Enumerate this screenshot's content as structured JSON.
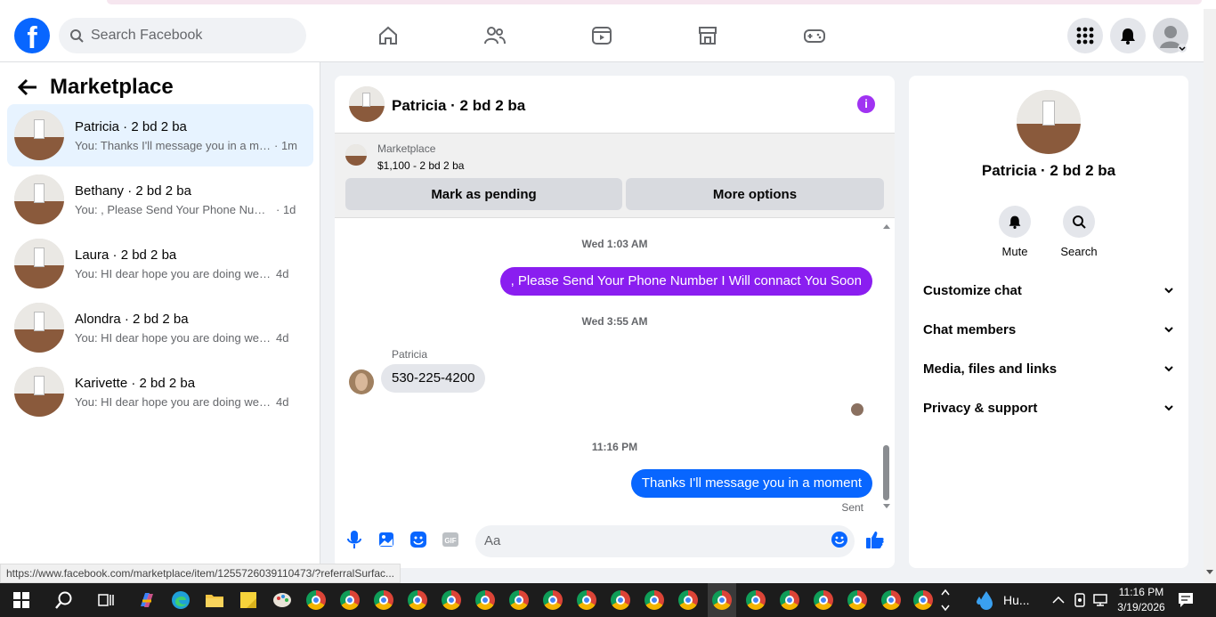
{
  "header": {
    "logo": "f",
    "search_placeholder": "Search Facebook",
    "nav_icons": [
      "home-icon",
      "friends-icon",
      "video-icon",
      "marketplace-icon",
      "gaming-icon"
    ],
    "right_icons": [
      "menu-grid-icon",
      "bell-icon",
      "account-avatar"
    ]
  },
  "sidebar": {
    "title": "Marketplace",
    "conversations": [
      {
        "name": "Patricia · 2 bd 2 ba",
        "preview": "You: Thanks I'll message you in a mo...",
        "time": "· 1m",
        "active": true
      },
      {
        "name": "Bethany · 2 bd 2 ba",
        "preview": "You: , Please Send Your Phone Numbe...",
        "time": "· 1d"
      },
      {
        "name": "Laura · 2 bd 2 ba",
        "preview": "You: HI dear hope you are doing well. ...",
        "time": "4d"
      },
      {
        "name": "Alondra · 2 bd 2 ba",
        "preview": "You: HI dear hope you are doing well. ...",
        "time": "4d"
      },
      {
        "name": "Karivette · 2 bd 2 ba",
        "preview": "You: HI dear hope you are doing well. ...",
        "time": "4d"
      }
    ]
  },
  "chat": {
    "title": "Patricia · 2 bd 2 ba",
    "listing_label": "Marketplace",
    "listing_detail": "$1,100 - 2 bd 2 ba",
    "mark_pending": "Mark as pending",
    "more_options": "More options",
    "messages": [
      {
        "type": "time",
        "text": "Wed 1:03 AM"
      },
      {
        "type": "out",
        "text": ", Please Send Your Phone Number I Will connact You Soon"
      },
      {
        "type": "time",
        "text": "Wed 3:55 AM"
      },
      {
        "type": "sender",
        "text": "Patricia"
      },
      {
        "type": "in",
        "text": "530-225-4200"
      },
      {
        "type": "time",
        "text": "11:16 PM"
      },
      {
        "type": "out",
        "text": "Thanks I'll message you in a moment"
      },
      {
        "type": "status",
        "text": "Sent"
      }
    ],
    "input_placeholder": "Aa"
  },
  "details": {
    "name": "Patricia · 2 bd 2 ba",
    "mute": "Mute",
    "search": "Search",
    "sections": [
      "Customize chat",
      "Chat members",
      "Media, files and links",
      "Privacy & support"
    ]
  },
  "status_url": "https://www.facebook.com/marketplace/item/1255726039110473/?referralSurfac...",
  "taskbar": {
    "weather": "Hu...",
    "time": "11:16 PM",
    "date": "3/19/2026"
  },
  "colors": {
    "brand": "#0866ff",
    "accent_purple": "#8a1ef0",
    "active_row": "#e7f3ff"
  }
}
